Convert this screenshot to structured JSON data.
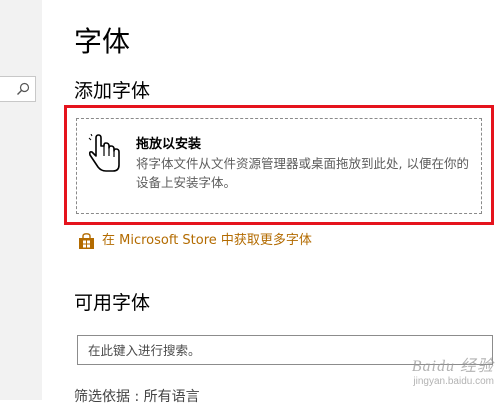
{
  "page": {
    "title": "字体",
    "add_section_title": "添加字体",
    "drop_zone": {
      "title": "拖放以安装",
      "description": "将字体文件从文件资源管理器或桌面拖放到此处, 以便在你的设备上安装字体。"
    },
    "store_link": {
      "icon": "store-bag-icon",
      "text": "在 Microsoft Store 中获取更多字体"
    },
    "available_section_title": "可用字体",
    "search": {
      "placeholder": "在此键入进行搜索。",
      "value": ""
    },
    "partial_bottom_text": "筛选依据 : 所有语言"
  },
  "sidebar": {
    "search_icon": "search-icon"
  },
  "watermark": {
    "logo": "Baidu 经验",
    "sub": "jingyan.baidu.com"
  },
  "colors": {
    "accent": "#b36b00",
    "highlight_border": "#e5131d"
  }
}
